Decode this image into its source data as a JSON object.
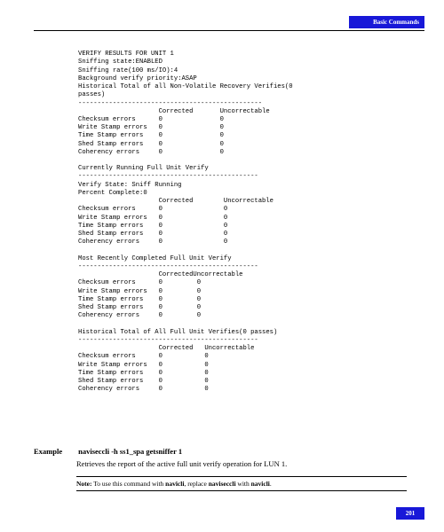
{
  "header": {
    "section": "Basic Commands"
  },
  "console": {
    "lines": "VERIFY RESULTS FOR UNIT 1\nSniffing state:ENABLED\nSniffing rate(100 ms/IO):4\nBackground verify priority:ASAP\nHistorical Total of all Non-Volatile Recovery Verifies(0\npasses)\n------------------------------------------------\n                     Corrected       Uncorrectable\nChecksum errors      0               0\nWrite Stamp errors   0               0\nTime Stamp errors    0               0\nShed Stamp errors    0               0\nCoherency errors     0               0\n\nCurrently Running Full Unit Verify\n-----------------------------------------------\nVerify State: Sniff Running\nPercent Complete:0\n                     Corrected        Uncorrectable\nChecksum errors      0                0\nWrite Stamp errors   0                0\nTime Stamp errors    0                0\nShed Stamp errors    0                0\nCoherency errors     0                0\n\nMost Recently Completed Full Unit Verify\n-----------------------------------------------\n                     CorrectedUncorrectable\nChecksum errors      0         0\nWrite Stamp errors   0         0\nTime Stamp errors    0         0\nShed Stamp errors    0         0\nCoherency errors     0         0\n\nHistorical Total of All Full Unit Verifies(0 passes)\n-----------------------------------------------\n                     Corrected   Uncorrectable\nChecksum errors      0           0\nWrite Stamp errors   0           0\nTime Stamp errors    0           0\nShed Stamp errors    0           0\nCoherency errors     0           0"
  },
  "example": {
    "label": "Example",
    "command": "naviseccli -h   ss1_spa   getsniffer 1",
    "description": "Retrieves the report of the active full unit verify operation for LUN 1."
  },
  "note": {
    "prefix": "Note:",
    "body_a": " To use this command with ",
    "bold_a": "navicli",
    "body_b": ", replace ",
    "bold_b": "naviseccli",
    "body_c": " with ",
    "bold_c": "navicli",
    "body_d": "."
  },
  "footer": {
    "page_number": "201"
  }
}
